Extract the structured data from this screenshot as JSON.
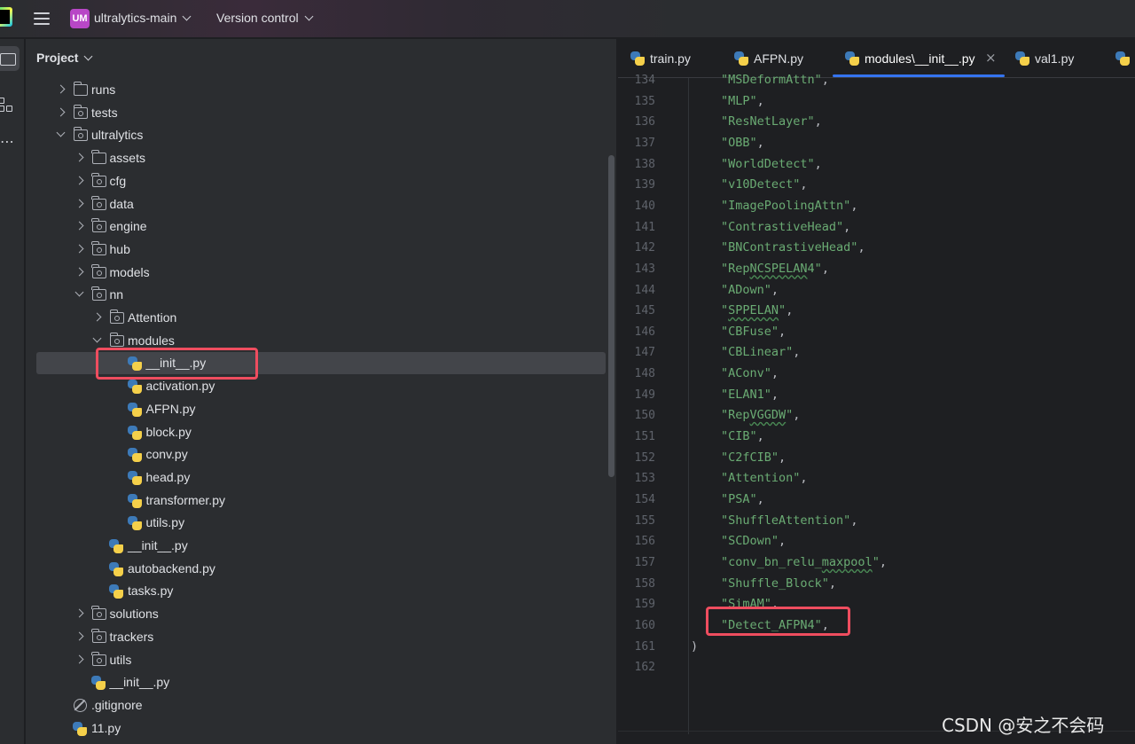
{
  "titlebar": {
    "project_badge": "UM",
    "project_name": "ultralytics-main",
    "vcs_label": "Version control"
  },
  "project_panel": {
    "title": "Project",
    "tree": [
      {
        "label": "runs",
        "kind": "folder",
        "depth": 1,
        "expanded": false
      },
      {
        "label": "tests",
        "kind": "package",
        "depth": 1,
        "expanded": false
      },
      {
        "label": "ultralytics",
        "kind": "package",
        "depth": 1,
        "expanded": true
      },
      {
        "label": "assets",
        "kind": "folder",
        "depth": 2,
        "expanded": false
      },
      {
        "label": "cfg",
        "kind": "package",
        "depth": 2,
        "expanded": false
      },
      {
        "label": "data",
        "kind": "package",
        "depth": 2,
        "expanded": false
      },
      {
        "label": "engine",
        "kind": "package",
        "depth": 2,
        "expanded": false
      },
      {
        "label": "hub",
        "kind": "package",
        "depth": 2,
        "expanded": false
      },
      {
        "label": "models",
        "kind": "package",
        "depth": 2,
        "expanded": false
      },
      {
        "label": "nn",
        "kind": "package",
        "depth": 2,
        "expanded": true
      },
      {
        "label": "Attention",
        "kind": "package",
        "depth": 3,
        "expanded": false
      },
      {
        "label": "modules",
        "kind": "package",
        "depth": 3,
        "expanded": true
      },
      {
        "label": "__init__.py",
        "kind": "python",
        "depth": 4,
        "selected": true
      },
      {
        "label": "activation.py",
        "kind": "python",
        "depth": 4
      },
      {
        "label": "AFPN.py",
        "kind": "python",
        "depth": 4
      },
      {
        "label": "block.py",
        "kind": "python",
        "depth": 4
      },
      {
        "label": "conv.py",
        "kind": "python",
        "depth": 4
      },
      {
        "label": "head.py",
        "kind": "python",
        "depth": 4
      },
      {
        "label": "transformer.py",
        "kind": "python",
        "depth": 4
      },
      {
        "label": "utils.py",
        "kind": "python",
        "depth": 4
      },
      {
        "label": "__init__.py",
        "kind": "python",
        "depth": 3
      },
      {
        "label": "autobackend.py",
        "kind": "python",
        "depth": 3
      },
      {
        "label": "tasks.py",
        "kind": "python",
        "depth": 3
      },
      {
        "label": "solutions",
        "kind": "package",
        "depth": 2,
        "expanded": false
      },
      {
        "label": "trackers",
        "kind": "package",
        "depth": 2,
        "expanded": false
      },
      {
        "label": "utils",
        "kind": "package",
        "depth": 2,
        "expanded": false
      },
      {
        "label": "__init__.py",
        "kind": "python",
        "depth": 2
      },
      {
        "label": ".gitignore",
        "kind": "ignore",
        "depth": 1
      },
      {
        "label": "11.py",
        "kind": "python",
        "depth": 1
      }
    ]
  },
  "editor": {
    "tabs": [
      {
        "label": "train.py",
        "active": false
      },
      {
        "label": "AFPN.py",
        "active": false
      },
      {
        "label": "modules\\__init__.py",
        "active": true
      },
      {
        "label": "val1.py",
        "active": false
      }
    ],
    "close_glyph": "×",
    "lines": [
      {
        "n": "134",
        "text": "\"MSDeformAttn\","
      },
      {
        "n": "135",
        "text": "\"MLP\","
      },
      {
        "n": "136",
        "text": "\"ResNetLayer\","
      },
      {
        "n": "137",
        "text": "\"OBB\","
      },
      {
        "n": "138",
        "text": "\"WorldDetect\","
      },
      {
        "n": "139",
        "text": "\"v10Detect\","
      },
      {
        "n": "140",
        "text": "\"ImagePoolingAttn\","
      },
      {
        "n": "141",
        "text": "\"ContrastiveHead\","
      },
      {
        "n": "142",
        "text": "\"BNContrastiveHead\","
      },
      {
        "n": "143",
        "text": "\"RepNCSPELAN4\","
      },
      {
        "n": "144",
        "text": "\"ADown\","
      },
      {
        "n": "145",
        "text": "\"SPPELAN\","
      },
      {
        "n": "146",
        "text": "\"CBFuse\","
      },
      {
        "n": "147",
        "text": "\"CBLinear\","
      },
      {
        "n": "148",
        "text": "\"AConv\","
      },
      {
        "n": "149",
        "text": "\"ELAN1\","
      },
      {
        "n": "150",
        "text": "\"RepVGGDW\","
      },
      {
        "n": "151",
        "text": "\"CIB\","
      },
      {
        "n": "152",
        "text": "\"C2fCIB\","
      },
      {
        "n": "153",
        "text": "\"Attention\","
      },
      {
        "n": "154",
        "text": "\"PSA\","
      },
      {
        "n": "155",
        "text": "\"ShuffleAttention\","
      },
      {
        "n": "156",
        "text": "\"SCDown\","
      },
      {
        "n": "157",
        "text": "\"conv_bn_relu_maxpool\","
      },
      {
        "n": "158",
        "text": "\"Shuffle_Block\","
      },
      {
        "n": "159",
        "text": "\"SimAM\","
      },
      {
        "n": "160",
        "text": "\"Detect_AFPN4\","
      },
      {
        "n": "161",
        "text": ")"
      },
      {
        "n": "162",
        "text": ""
      }
    ]
  },
  "watermark": "CSDN @安之不会码",
  "colors": {
    "string": "#6aab73",
    "highlight_box": "#ef4d5f",
    "active_tab_underline": "#3574f0",
    "project_badge": "#b847c6"
  }
}
